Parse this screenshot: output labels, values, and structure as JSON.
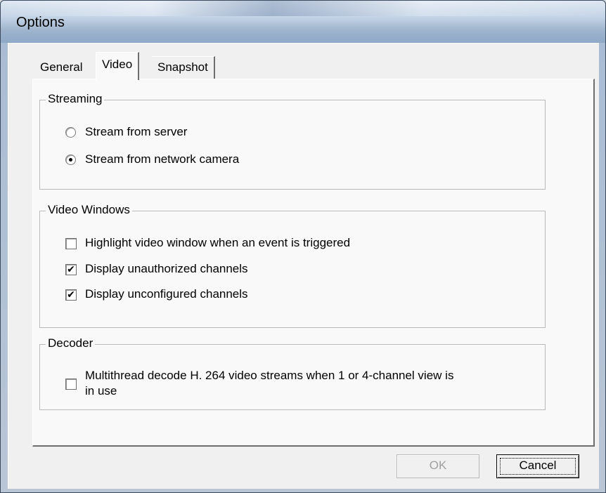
{
  "window": {
    "title": "Options"
  },
  "tabs": [
    {
      "label": "General",
      "selected": false
    },
    {
      "label": "Video",
      "selected": true
    },
    {
      "label": "Snapshot",
      "selected": false
    }
  ],
  "streaming": {
    "title": "Streaming",
    "options": [
      {
        "label": "Stream from server",
        "checked": false
      },
      {
        "label": "Stream from network camera",
        "checked": true
      }
    ]
  },
  "video_windows": {
    "title": "Video Windows",
    "options": [
      {
        "label": "Highlight video window when an event is triggered",
        "checked": false
      },
      {
        "label": "Display unauthorized channels",
        "checked": true
      },
      {
        "label": "Display unconfigured channels",
        "checked": true
      }
    ]
  },
  "decoder": {
    "title": "Decoder",
    "options": [
      {
        "label_line1": "Multithread decode H. 264 video streams when 1 or 4-channel view is",
        "label_line2": "in use",
        "checked": false
      }
    ]
  },
  "buttons": {
    "ok": {
      "label": "OK",
      "enabled": false
    },
    "cancel": {
      "label": "Cancel",
      "enabled": true,
      "focused": true
    }
  }
}
